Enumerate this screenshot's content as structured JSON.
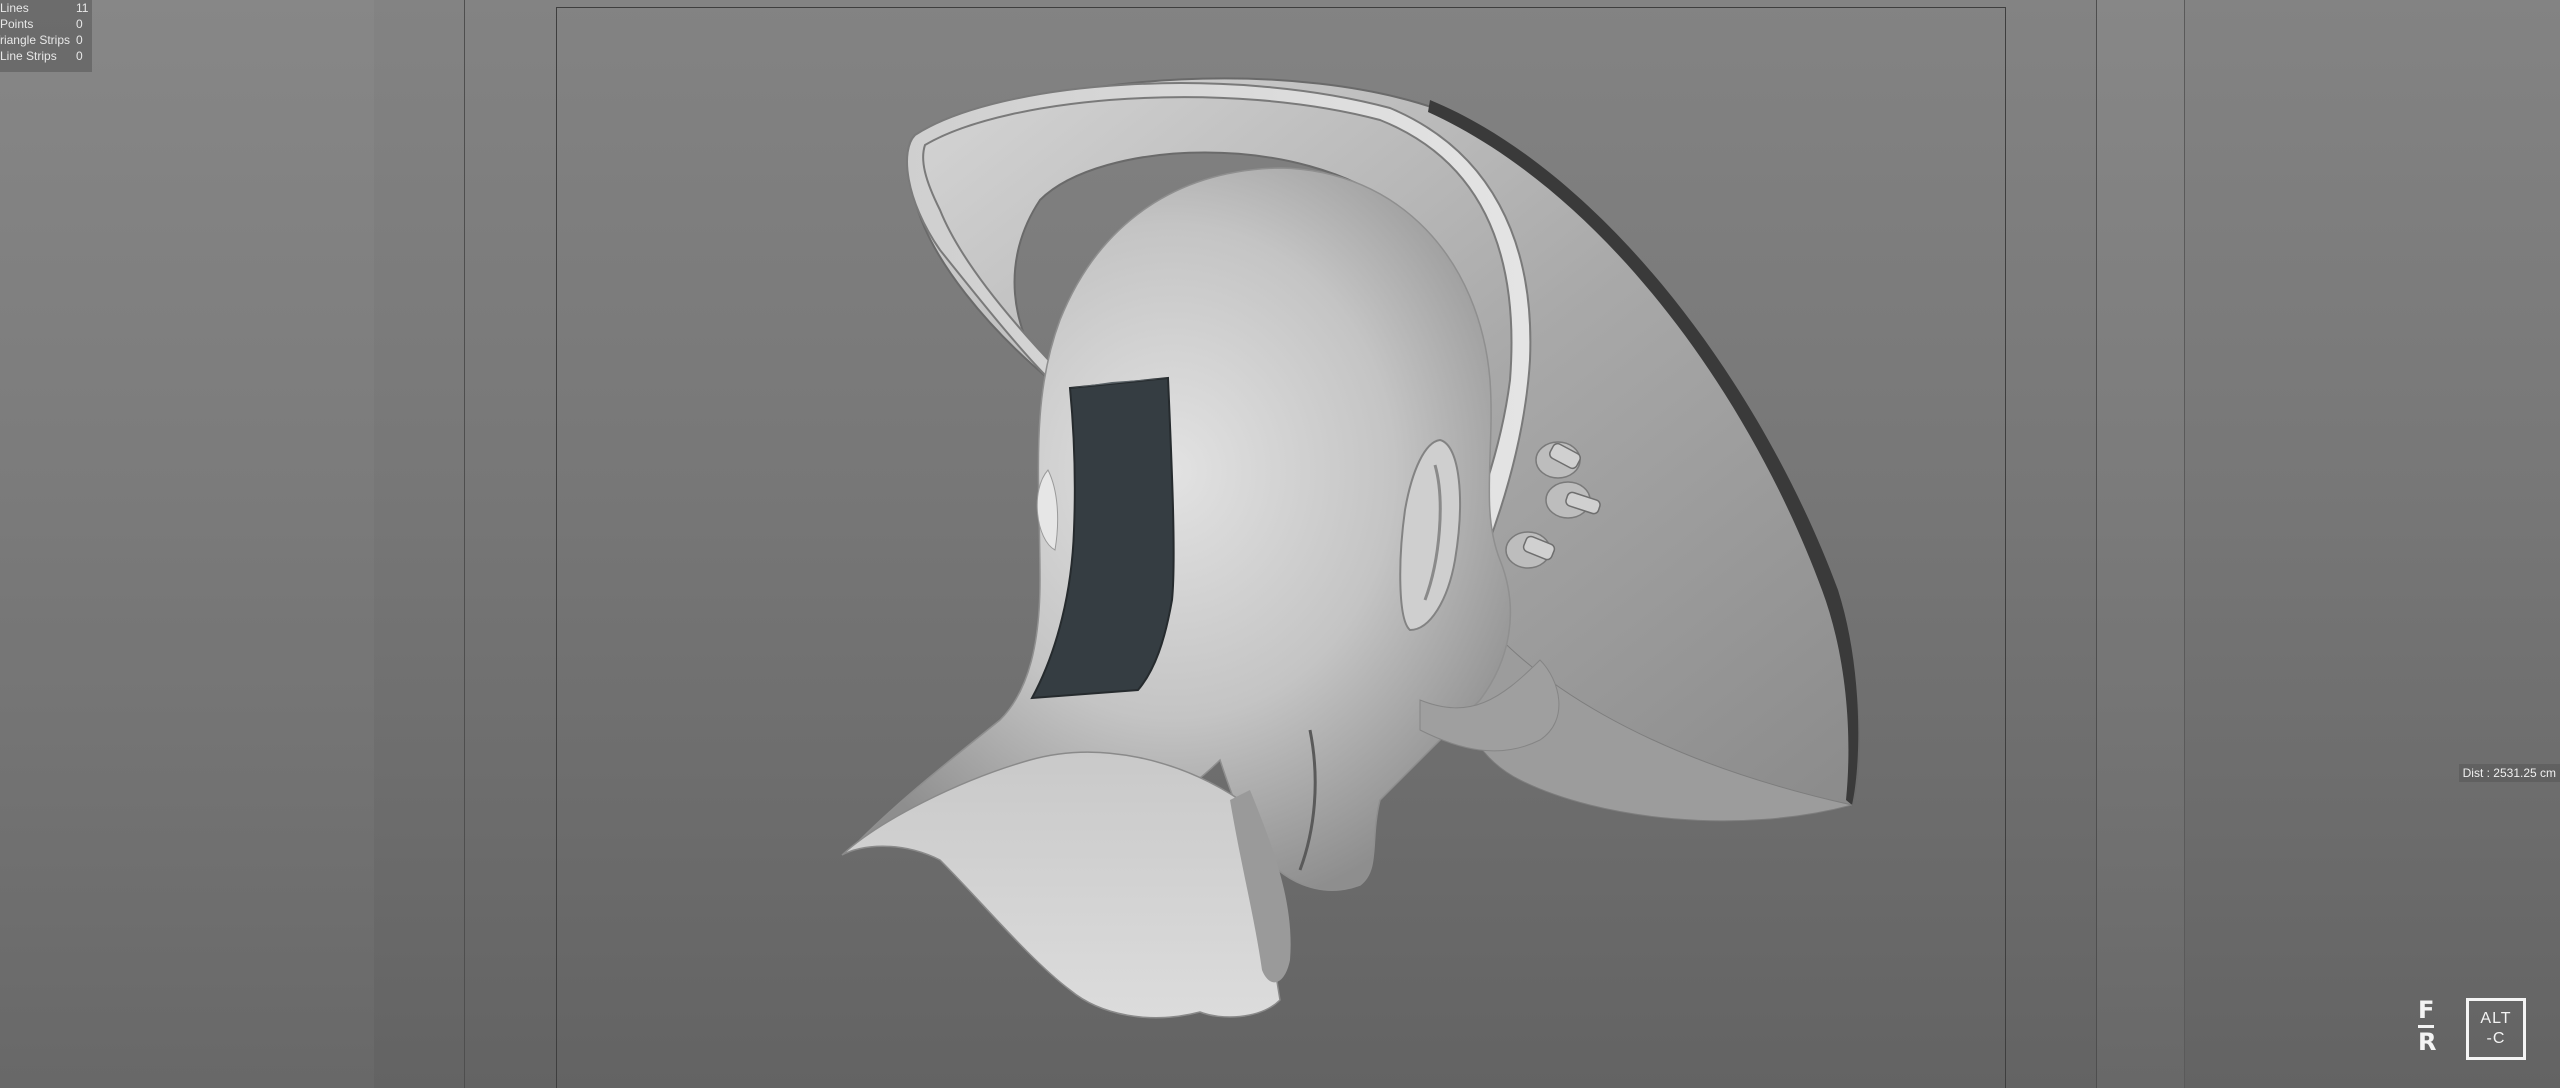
{
  "stats_overlay": {
    "rows": [
      {
        "label": "Lines",
        "value": "11"
      },
      {
        "label": "Points",
        "value": "0"
      },
      {
        "label": "Triangle Strips",
        "value": "0"
      },
      {
        "label": "Line Strips",
        "value": "0"
      }
    ]
  },
  "viewport": {
    "distance_readout": "Dist : 2531.25 cm",
    "model_description_icon": "helmet-head-model"
  },
  "watermarks": {
    "fr_logo": {
      "top": "F",
      "bottom": "R"
    },
    "alt_c_logo": {
      "line1": "ALT",
      "line2": "-C"
    }
  },
  "colors": {
    "viewport_top": "#838383",
    "viewport_bottom": "#636363",
    "visor": "#353d42",
    "model_light": "#d8d8d8",
    "model_shadow": "#8a8a8a"
  }
}
